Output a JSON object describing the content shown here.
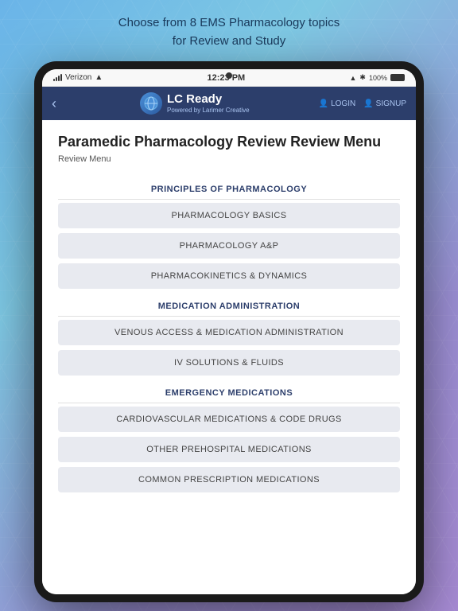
{
  "background": {
    "top_text_line1": "Choose from 8 EMS Pharmacology topics",
    "top_text_line2": "for Review and Study"
  },
  "status_bar": {
    "carrier": "Verizon",
    "wifi": "wifi",
    "time": "12:23 PM",
    "bluetooth": "BT",
    "battery_percent": "100%"
  },
  "nav": {
    "back_icon": "‹",
    "logo_icon": "🌐",
    "title": "LC Ready",
    "subtitle": "Powered by Larimer Creative",
    "login_label": "LOGIN",
    "signup_label": "SIGNUP",
    "login_icon": "👤",
    "signup_icon": "👤"
  },
  "page": {
    "title": "Paramedic Pharmacology Review Review Menu",
    "breadcrumb": "Review Menu"
  },
  "sections": [
    {
      "header": "PRINCIPLES OF PHARMACOLOGY",
      "items": [
        "PHARMACOLOGY BASICS",
        "PHARMACOLOGY A&P",
        "PHARMACOKINETICS & DYNAMICS"
      ]
    },
    {
      "header": "MEDICATION ADMINISTRATION",
      "items": [
        "VENOUS ACCESS & MEDICATION ADMINISTRATION",
        "IV SOLUTIONS & FLUIDS"
      ]
    },
    {
      "header": "EMERGENCY MEDICATIONS",
      "items": [
        "CARDIOVASCULAR MEDICATIONS & CODE DRUGS",
        "OTHER PREHOSPITAL MEDICATIONS",
        "COMMON PRESCRIPTION MEDICATIONS"
      ]
    }
  ]
}
